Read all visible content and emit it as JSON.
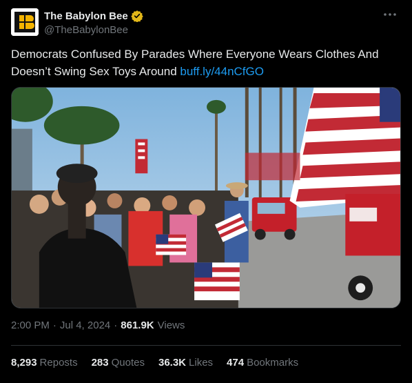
{
  "author": {
    "display_name": "The Babylon Bee",
    "handle": "@TheBabylonBee",
    "verified_icon": "verified-gold-badge-icon",
    "avatar_icon": "babylon-bee-logo"
  },
  "tweet": {
    "text": "Democrats Confused By Parades Where Everyone Wears Clothes And Doesn’t Swing Sex Toys Around ",
    "link": "buff.ly/44nCfGO"
  },
  "media": {
    "description_icon": "parade-photo"
  },
  "meta": {
    "time": "2:00 PM",
    "sep1": "·",
    "date": "Jul 4, 2024",
    "sep2": "·",
    "views": "861.9K",
    "views_label": "Views"
  },
  "stats": {
    "reposts": "8,293",
    "reposts_label": "Reposts",
    "quotes": "283",
    "quotes_label": "Quotes",
    "likes": "36.3K",
    "likes_label": "Likes",
    "bookmarks": "474",
    "bookmarks_label": "Bookmarks"
  },
  "colors": {
    "background": "#000000",
    "text": "#e7e9ea",
    "muted": "#71767b",
    "link": "#1d9bf0",
    "verified": "#e2b719"
  }
}
